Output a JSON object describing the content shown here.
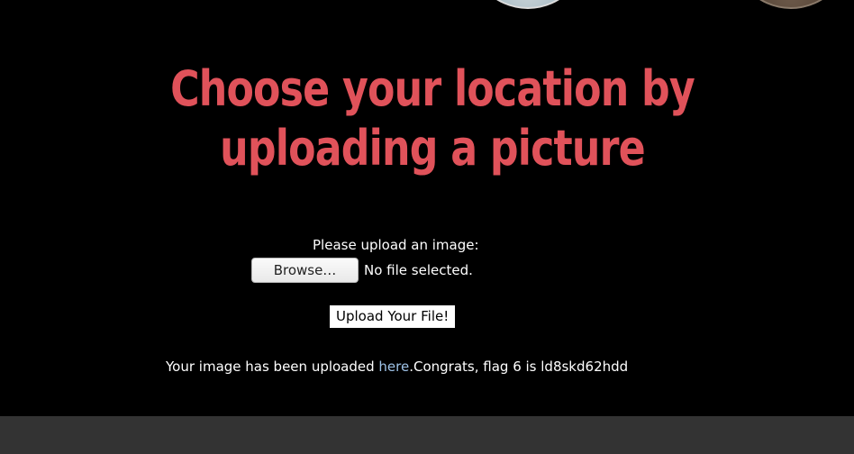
{
  "hero": {
    "title": "Choose your location by uploading a picture"
  },
  "upload_form": {
    "label": "Please upload an image:",
    "browse_label": "Browse…",
    "file_status": "No file selected.",
    "submit_label": "Upload Your File!"
  },
  "result": {
    "prefix": "Your image has been uploaded ",
    "link_text": "here",
    "suffix": ".Congrats, flag 6 is ld8skd62hdd"
  },
  "colors": {
    "background": "#000000",
    "title": "#e0525a",
    "link": "#9fc3e8",
    "footer": "#333333"
  }
}
